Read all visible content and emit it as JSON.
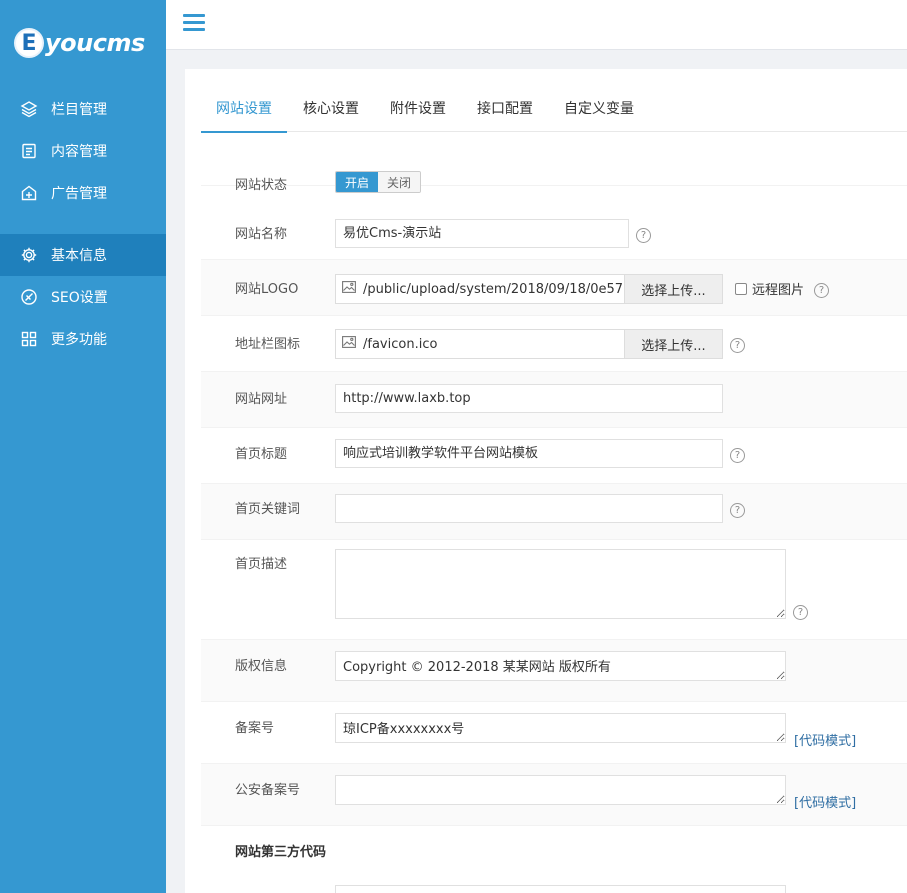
{
  "brand": {
    "badge": "E",
    "name": "youcms"
  },
  "sidebar": {
    "items": [
      {
        "label": "栏目管理",
        "icon": "layers-icon"
      },
      {
        "label": "内容管理",
        "icon": "document-icon"
      },
      {
        "label": "广告管理",
        "icon": "ad-icon"
      },
      {
        "label": "基本信息",
        "icon": "gear-icon",
        "active": true
      },
      {
        "label": "SEO设置",
        "icon": "seo-icon"
      },
      {
        "label": "更多功能",
        "icon": "grid-icon"
      }
    ]
  },
  "tabs": [
    "网站设置",
    "核心设置",
    "附件设置",
    "接口配置",
    "自定义变量"
  ],
  "form": {
    "status": {
      "label": "网站状态",
      "on": "开启",
      "off": "关闭"
    },
    "name": {
      "label": "网站名称",
      "value": "易优Cms-演示站"
    },
    "logo": {
      "label": "网站LOGO",
      "value": "/public/upload/system/2018/09/18/0e57",
      "button": "选择上传...",
      "remote_label": "远程图片"
    },
    "favicon": {
      "label": "地址栏图标",
      "value": "/favicon.ico",
      "button": "选择上传..."
    },
    "url": {
      "label": "网站网址",
      "value": "http://www.laxb.top"
    },
    "title": {
      "label": "首页标题",
      "value": "响应式培训教学软件平台网站模板"
    },
    "keywords": {
      "label": "首页关键词",
      "value": ""
    },
    "description": {
      "label": "首页描述",
      "value": ""
    },
    "copyright": {
      "label": "版权信息",
      "value": "Copyright © 2012-2018 某某网站 版权所有"
    },
    "icp": {
      "label": "备案号",
      "value": "琼ICP备xxxxxxxx号",
      "link": "[代码模式]"
    },
    "police": {
      "label": "公安备案号",
      "value": "",
      "link": "[代码模式]"
    },
    "third_party": {
      "label": "网站第三方代码"
    }
  },
  "colors": {
    "primary": "#3598d1",
    "sidebar_active": "#1f80bc"
  }
}
